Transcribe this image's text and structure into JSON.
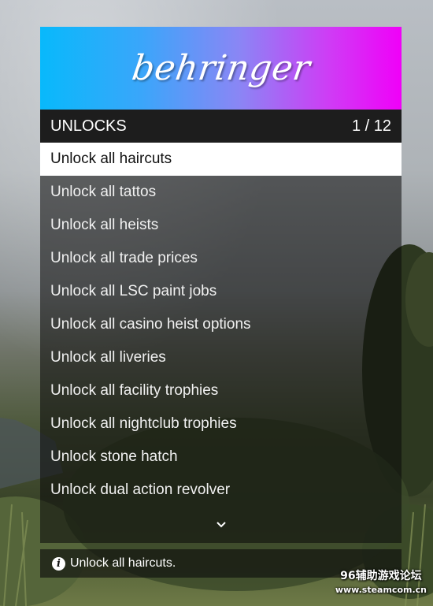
{
  "menu": {
    "banner_title": "behringer",
    "section_title": "UNLOCKS",
    "page_counter": "1 / 12",
    "items": [
      {
        "label": "Unlock all haircuts",
        "selected": true
      },
      {
        "label": "Unlock all tattos",
        "selected": false
      },
      {
        "label": "Unlock all heists",
        "selected": false
      },
      {
        "label": "Unlock all trade prices",
        "selected": false
      },
      {
        "label": "Unlock all LSC paint jobs",
        "selected": false
      },
      {
        "label": "Unlock all casino heist options",
        "selected": false
      },
      {
        "label": "Unlock all liveries",
        "selected": false
      },
      {
        "label": "Unlock all facility trophies",
        "selected": false
      },
      {
        "label": "Unlock all nightclub trophies",
        "selected": false
      },
      {
        "label": "Unlock stone hatch",
        "selected": false
      },
      {
        "label": "Unlock dual action revolver",
        "selected": false
      }
    ],
    "scroll_icon": "chevron-down-icon"
  },
  "footer": {
    "icon": "info-icon",
    "description": "Unlock all haircuts."
  },
  "watermark": {
    "line1": "96辅助游戏论坛",
    "line2": "www.steamcom.cn"
  },
  "colors": {
    "banner_gradient_start": "#08b9fb",
    "banner_gradient_end": "#f000f8",
    "subheader_bg": "#1d1d1d",
    "selected_bg": "#ffffff"
  }
}
